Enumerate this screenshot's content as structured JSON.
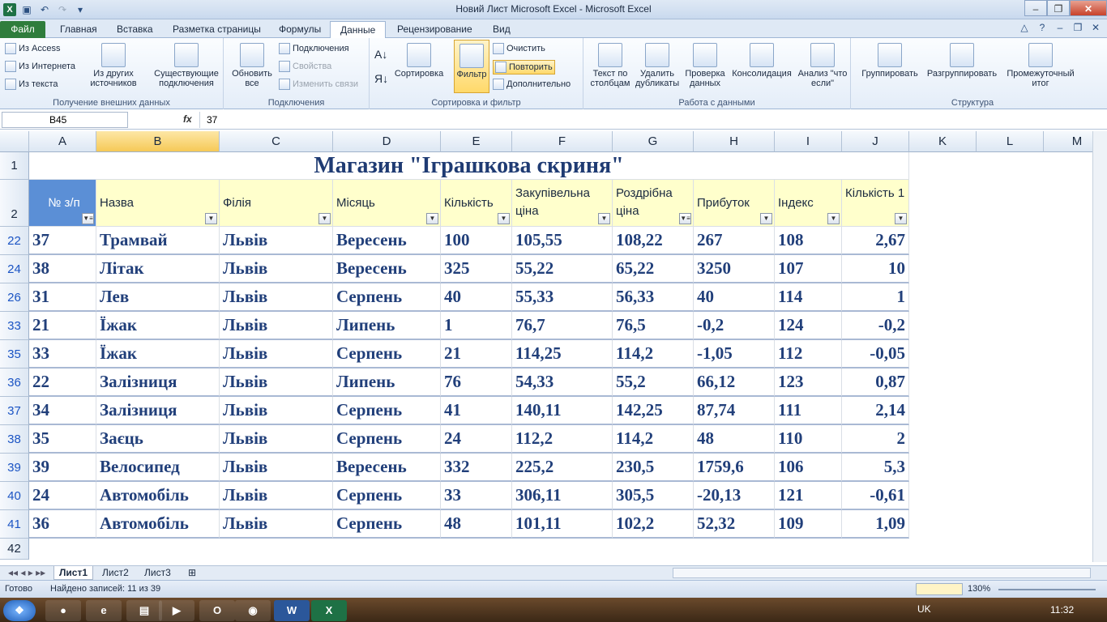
{
  "window": {
    "title": "Новий Лист Microsoft Excel  -  Microsoft Excel"
  },
  "tabs": [
    "Файл",
    "Главная",
    "Вставка",
    "Разметка страницы",
    "Формулы",
    "Данные",
    "Рецензирование",
    "Вид"
  ],
  "ribbon": {
    "ext": {
      "access": "Из Access",
      "web": "Из Интернета",
      "text": "Из текста",
      "other": "Из других источников",
      "existing": "Существующие подключения",
      "label": "Получение внешних данных"
    },
    "conn": {
      "refresh": "Обновить все",
      "connections": "Подключения",
      "properties": "Свойства",
      "editlinks": "Изменить связи",
      "label": "Подключения"
    },
    "sort": {
      "sort": "Сортировка",
      "filter": "Фильтр",
      "clear": "Очистить",
      "reapply": "Повторить",
      "advanced": "Дополнительно",
      "label": "Сортировка и фильтр"
    },
    "tools": {
      "t2c": "Текст по столбцам",
      "dup": "Удалить дубликаты",
      "valid": "Проверка данных",
      "cons": "Консолидация",
      "whatif": "Анализ \"что если\"",
      "label": "Работа с данными"
    },
    "outline": {
      "group": "Группировать",
      "ungroup": "Разгруппировать",
      "subtotal": "Промежуточный итог",
      "label": "Структура"
    }
  },
  "formula": {
    "namebox": "B45",
    "fx": "fx",
    "value": "37"
  },
  "columns": [
    "A",
    "B",
    "C",
    "D",
    "E",
    "F",
    "G",
    "H",
    "I",
    "J",
    "K",
    "L",
    "M"
  ],
  "sheet_title": "Магазин \"Іграшкова скриня\"",
  "headers": [
    "№ з/п",
    "Назва",
    "Філія",
    "Місяць",
    "Кількість",
    "Закупівельна ціна",
    "Роздрібна ціна",
    "Прибуток",
    "Індекс",
    "Кількість 1"
  ],
  "row_numbers": [
    "1",
    "2",
    "22",
    "24",
    "26",
    "33",
    "35",
    "36",
    "37",
    "38",
    "39",
    "40",
    "41",
    "42"
  ],
  "rows": [
    [
      "37",
      "Трамвай",
      "Львів",
      "Вересень",
      "100",
      "105,55",
      "108,22",
      "267",
      "108",
      "2,67"
    ],
    [
      "38",
      "Літак",
      "Львів",
      "Вересень",
      "325",
      "55,22",
      "65,22",
      "3250",
      "107",
      "10"
    ],
    [
      "31",
      "Лев",
      "Львів",
      "Серпень",
      "40",
      "55,33",
      "56,33",
      "40",
      "114",
      "1"
    ],
    [
      "21",
      "Їжак",
      "Львів",
      "Липень",
      "1",
      "76,7",
      "76,5",
      "-0,2",
      "124",
      "-0,2"
    ],
    [
      "33",
      "Їжак",
      "Львів",
      "Серпень",
      "21",
      "114,25",
      "114,2",
      "-1,05",
      "112",
      "-0,05"
    ],
    [
      "22",
      "Залізниця",
      "Львів",
      "Липень",
      "76",
      "54,33",
      "55,2",
      "66,12",
      "123",
      "0,87"
    ],
    [
      "34",
      "Залізниця",
      "Львів",
      "Серпень",
      "41",
      "140,11",
      "142,25",
      "87,74",
      "111",
      "2,14"
    ],
    [
      "35",
      "Заєць",
      "Львів",
      "Серпень",
      "24",
      "112,2",
      "114,2",
      "48",
      "110",
      "2"
    ],
    [
      "39",
      "Велосипед",
      "Львів",
      "Вересень",
      "332",
      "225,2",
      "230,5",
      "1759,6",
      "106",
      "5,3"
    ],
    [
      "24",
      "Автомобіль",
      "Львів",
      "Серпень",
      "33",
      "306,11",
      "305,5",
      "-20,13",
      "121",
      "-0,61"
    ],
    [
      "36",
      "Автомобіль",
      "Львів",
      "Серпень",
      "48",
      "101,11",
      "102,2",
      "52,32",
      "109",
      "1,09"
    ]
  ],
  "sheets": [
    "Лист1",
    "Лист2",
    "Лист3"
  ],
  "status": {
    "ready": "Готово",
    "found": "Найдено записей: 11 из 39",
    "zoom": "130%"
  },
  "taskbar": {
    "lang": "UK",
    "time": "11:32"
  }
}
